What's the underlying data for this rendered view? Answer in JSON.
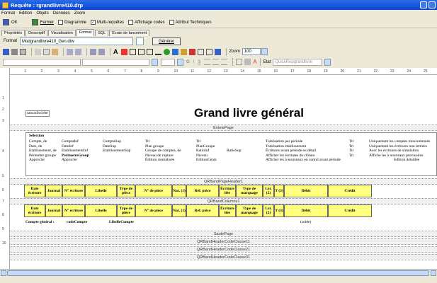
{
  "window": {
    "title": "Requête : rgrandlivre410.drp"
  },
  "menu": [
    "Format",
    "Edition",
    "Objets",
    "Données",
    "Zoom"
  ],
  "toolbar1": {
    "ok": "OK",
    "close": "Fermer",
    "diagram": "Diagramme",
    "multi": "Multi-requêtes",
    "show_codes": "Affichage codes",
    "tech_attr": "Attribut Techniques"
  },
  "tabs": [
    "Propriétés",
    "Descriptif",
    "Visualisation",
    "Format",
    "SQL",
    "Ecran de lancement"
  ],
  "format_row": {
    "label": "Format",
    "value": "Modgrandlivre410_Gen.dtw",
    "generate": "Générer"
  },
  "toolbar2": {
    "zoom_label": "Zoom",
    "zoom_value": "100"
  },
  "toolbar3": {
    "etat_label": "Etat",
    "etat_value": "QuickRepgrandlivre"
  },
  "ruler": [
    "1",
    "2",
    "3",
    "4",
    "5",
    "6",
    "7",
    "8",
    "9",
    "10",
    "11",
    "12",
    "13",
    "14",
    "15",
    "16",
    "17",
    "18",
    "19",
    "20",
    "21",
    "22",
    "23",
    "24",
    "25"
  ],
  "report": {
    "raison_sociale": "raisonSociété",
    "title": "Grand livre général",
    "band_entete": "EntetePage",
    "selection_title": "Sélection",
    "sel_col1": [
      "Compte, de",
      "Date, de",
      "Etablissement, de",
      "Périmètre groupe",
      "Approche"
    ],
    "sel_col2": [
      "ComptaInf",
      "DateInf",
      "EtablissementInf",
      "PerimetreGroup",
      "Approche"
    ],
    "sel_col3": [
      "ComptaSup",
      "DateSup",
      "EtablissementSup"
    ],
    "sel_col4": [
      "Tri",
      "Plan groupe",
      "Groupe de comptes, de",
      "Niveau de rupture",
      "Édition centralisée"
    ],
    "sel_col5": [
      "Tri",
      "PlanGroupe",
      "RatioInf",
      "Niveau",
      "EditionCentr."
    ],
    "sel_col6": [
      "RatioSup"
    ],
    "sel_col7": [
      "Totalisation par période",
      "Totalisation établissement",
      "Écritures avant période en détail",
      "Afficher les écritures de clôture",
      "Afficher les à-nouveaux en cumul avant période"
    ],
    "sel_col8": [
      "Tri",
      "Tri",
      "Tri",
      "Tri"
    ],
    "sel_col9": [
      "Uniquement les comptes mouvementés",
      "Uniquement les écritures non lettrées",
      "Avec les écritures de simulation",
      "Affiche les à nouveaux provisoires",
      "Edition détaillée"
    ],
    "band_page_header": "QRBandPageHeader1",
    "band_columns": "QRBandColumns1",
    "headers": [
      "Date écriture",
      "Journal",
      "N° écriture",
      "Libellé",
      "Type de pièce",
      "N° de pièce",
      "Nat. (1)",
      "Réf. pièce",
      "Écriture liée",
      "Type de marquage",
      "Let. (2)",
      "T (3)",
      "Débit",
      "Crédit"
    ],
    "compte_label": "Compte général :",
    "code_compte": "codeCompte",
    "libelle_compte": "LibelleCompte",
    "solde_label": "(solde)",
    "band_saute": "SautePage",
    "band_h1": "QRBandHeaderCodeClasse11",
    "band_h2": "QRBandHeaderCodeClasse21",
    "band_h3": "QRBandHeaderCodeClasse31"
  }
}
